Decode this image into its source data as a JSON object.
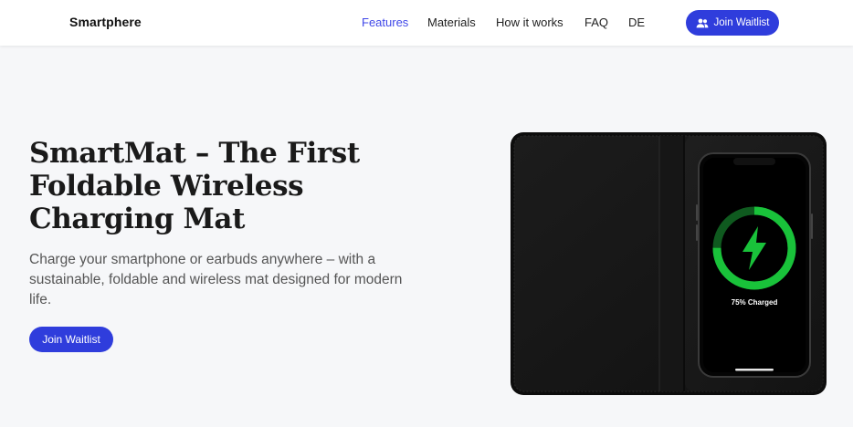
{
  "header": {
    "brand": "Smartphere",
    "nav": [
      {
        "label": "Features",
        "active": true
      },
      {
        "label": "Materials",
        "active": false
      },
      {
        "label": "How it works",
        "active": false
      },
      {
        "label": "FAQ",
        "active": false
      },
      {
        "label": "DE",
        "active": false
      }
    ],
    "cta_label": "Join Waitlist",
    "cta_icon": "users-icon"
  },
  "hero": {
    "title": "SmartMat – The First Foldable Wireless Charging Mat",
    "subtitle": "Charge your smartphone or earbuds anywhere – with a sustainable, foldable and wireless mat designed for modern life.",
    "cta_label": "Join Waitlist"
  },
  "product_image": {
    "phone_status": "75% Charged",
    "charge_fraction": 0.75,
    "charge_icon": "lightning-bolt-icon"
  },
  "colors": {
    "accent": "#2f3ddc",
    "active_nav": "#3f47e8",
    "charge_green": "#19c23a"
  }
}
